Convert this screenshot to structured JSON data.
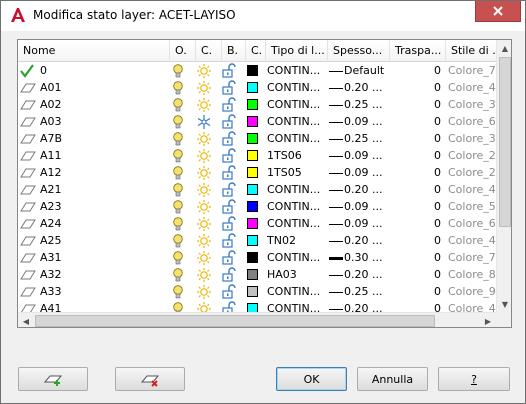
{
  "window": {
    "title": "Modifica stato layer: ACET-LAYISO",
    "close_glyph": "✕"
  },
  "columns": [
    {
      "label": "Nome"
    },
    {
      "label": "O."
    },
    {
      "label": "C."
    },
    {
      "label": "B."
    },
    {
      "label": "C."
    },
    {
      "label": "Tipo di l..."
    },
    {
      "label": "Spesso..."
    },
    {
      "label": "Traspa..."
    },
    {
      "label": "Stile di ..."
    }
  ],
  "rows": [
    {
      "name": "0",
      "current": true,
      "frozen": false,
      "color": "#000000",
      "linetype": "CONTIN...",
      "lineweight": "Default",
      "thick": false,
      "transparency": "0",
      "plotstyle": "Colore_7"
    },
    {
      "name": "A01",
      "current": false,
      "frozen": false,
      "color": "#00ffff",
      "linetype": "CONTIN...",
      "lineweight": "0.20 ...",
      "thick": false,
      "transparency": "0",
      "plotstyle": "Colore_4"
    },
    {
      "name": "A02",
      "current": false,
      "frozen": false,
      "color": "#00ff00",
      "linetype": "CONTIN...",
      "lineweight": "0.25 ...",
      "thick": false,
      "transparency": "0",
      "plotstyle": "Colore_3"
    },
    {
      "name": "A03",
      "current": false,
      "frozen": true,
      "color": "#ff00ff",
      "linetype": "CONTIN...",
      "lineweight": "0.09 ...",
      "thick": false,
      "transparency": "0",
      "plotstyle": "Colore_6"
    },
    {
      "name": "A7B",
      "current": false,
      "frozen": false,
      "color": "#00ff00",
      "linetype": "CONTIN...",
      "lineweight": "0.25 ...",
      "thick": false,
      "transparency": "0",
      "plotstyle": "Colore_3"
    },
    {
      "name": "A11",
      "current": false,
      "frozen": false,
      "color": "#ffff00",
      "linetype": "1TS06",
      "lineweight": "0.09 ...",
      "thick": false,
      "transparency": "0",
      "plotstyle": "Colore_2"
    },
    {
      "name": "A12",
      "current": false,
      "frozen": false,
      "color": "#ffff00",
      "linetype": "1TS05",
      "lineweight": "0.09 ...",
      "thick": false,
      "transparency": "0",
      "plotstyle": "Colore_2"
    },
    {
      "name": "A21",
      "current": false,
      "frozen": false,
      "color": "#00ffff",
      "linetype": "CONTIN...",
      "lineweight": "0.20 ...",
      "thick": false,
      "transparency": "0",
      "plotstyle": "Colore_4"
    },
    {
      "name": "A23",
      "current": false,
      "frozen": false,
      "color": "#0000ff",
      "linetype": "CONTIN...",
      "lineweight": "0.09 ...",
      "thick": false,
      "transparency": "0",
      "plotstyle": "Colore_5"
    },
    {
      "name": "A24",
      "current": false,
      "frozen": false,
      "color": "#ff00ff",
      "linetype": "CONTIN...",
      "lineweight": "0.09 ...",
      "thick": false,
      "transparency": "0",
      "plotstyle": "Colore_6"
    },
    {
      "name": "A25",
      "current": false,
      "frozen": false,
      "color": "#00ffff",
      "linetype": "TN02",
      "lineweight": "0.20 ...",
      "thick": false,
      "transparency": "0",
      "plotstyle": "Colore_4"
    },
    {
      "name": "A31",
      "current": false,
      "frozen": false,
      "color": "#000000",
      "linetype": "CONTIN...",
      "lineweight": "0.30 ...",
      "thick": true,
      "transparency": "0",
      "plotstyle": "Colore_7"
    },
    {
      "name": "A32",
      "current": false,
      "frozen": false,
      "color": "#808080",
      "linetype": "HA03",
      "lineweight": "0.20 ...",
      "thick": false,
      "transparency": "0",
      "plotstyle": "Colore_8"
    },
    {
      "name": "A33",
      "current": false,
      "frozen": false,
      "color": "#c0c0c0",
      "linetype": "CONTIN...",
      "lineweight": "0.25 ...",
      "thick": false,
      "transparency": "0",
      "plotstyle": "Colore_9"
    },
    {
      "name": "A41",
      "current": false,
      "frozen": false,
      "color": "#00ffff",
      "linetype": "CONTIN...",
      "lineweight": "0.20 ...",
      "thick": false,
      "transparency": "0",
      "plotstyle": "Colore_4"
    }
  ],
  "buttons": {
    "new_state": "new-layer-state",
    "delete_state": "delete-layer-state",
    "ok": "OK",
    "cancel": "Annulla",
    "help": "?"
  },
  "colors": {
    "current_check": "#2ea12e",
    "bulb": "#f5e26b",
    "sun": "#f0b400",
    "lock": "#3a78c8",
    "delete_x": "#d42020",
    "add_plus": "#2ea12e"
  }
}
